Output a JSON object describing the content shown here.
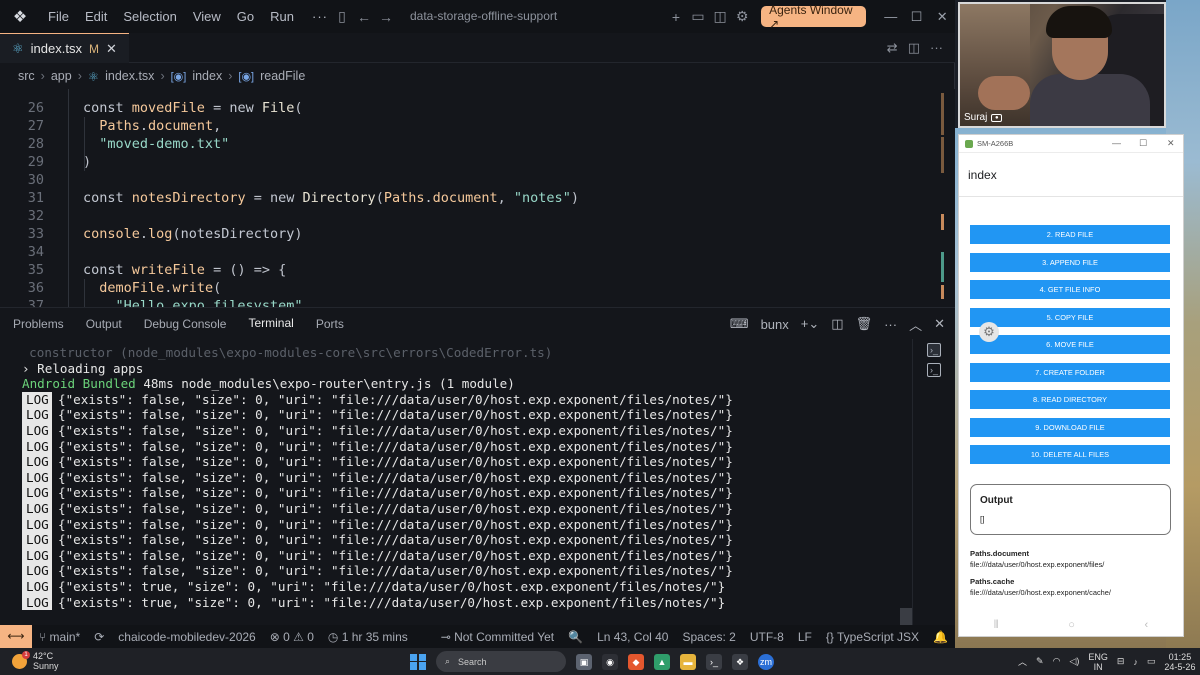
{
  "titlebar": {
    "menus": [
      "File",
      "Edit",
      "Selection",
      "View",
      "Go",
      "Run"
    ],
    "more": "···",
    "search_title": "data-storage-offline-support",
    "agents_button": "Agents Window ↗"
  },
  "tab": {
    "filename": "index.tsx",
    "modified": "M",
    "close": "✕"
  },
  "breadcrumb": [
    "src",
    "app",
    "index.tsx",
    "index",
    "readFile"
  ],
  "code_lines": [
    {
      "n": "26",
      "html": "<span class='kw'>const</span> <span class='var'>movedFile</span> <span class='pun'>=</span> <span class='kw'>new</span> <span class='cls'>File</span><span class='pun'>(</span>"
    },
    {
      "n": "27",
      "html": "  <span class='ob'>Paths</span><span class='pun'>.</span><span class='var'>document</span><span class='pun'>,</span>"
    },
    {
      "n": "28",
      "html": "  <span class='str'>\"moved-demo.txt\"</span>"
    },
    {
      "n": "29",
      "html": "<span class='pun'>)</span>"
    },
    {
      "n": "30",
      "html": ""
    },
    {
      "n": "31",
      "html": "<span class='kw'>const</span> <span class='var'>notesDirectory</span> <span class='pun'>=</span> <span class='kw'>new</span> <span class='cls'>Directory</span><span class='pun'>(</span><span class='ob'>Paths</span><span class='pun'>.</span><span class='var'>document</span><span class='pun'>,</span> <span class='str'>\"notes\"</span><span class='pun'>)</span>"
    },
    {
      "n": "32",
      "html": ""
    },
    {
      "n": "33",
      "html": "<span class='ob'>console</span><span class='pun'>.</span><span class='var'>log</span><span class='pun'>(</span><span class='kw'>notesDirectory</span><span class='pun'>)</span>"
    },
    {
      "n": "34",
      "html": ""
    },
    {
      "n": "35",
      "html": "<span class='kw'>const</span> <span class='var'>writeFile</span> <span class='pun'>= () =&gt; {</span>"
    },
    {
      "n": "36",
      "html": "  <span class='ob'>demoFile</span><span class='pun'>.</span><span class='var'>write</span><span class='pun'>(</span>"
    },
    {
      "n": "37",
      "html": "    <span class='str'>\"Hello expo filesystem\"</span>"
    }
  ],
  "panel": {
    "tabs": [
      "Problems",
      "Output",
      "Debug Console",
      "Terminal",
      "Ports"
    ],
    "active_tab": "Terminal",
    "shell": "bunx"
  },
  "terminal": {
    "faded_line": "  constructor (node_modules\\expo-modules-core\\src\\errors\\CodedError.ts)",
    "reload_line": "› Reloading apps",
    "bundled_prefix": "Android Bundled",
    "bundled_rest": " 48ms node_modules\\expo-router\\entry.js (1 module)",
    "log_badge": "LOG",
    "logs": [
      "{\"exists\": false, \"size\": 0, \"uri\": \"file:///data/user/0/host.exp.exponent/files/notes/\"}",
      "{\"exists\": false, \"size\": 0, \"uri\": \"file:///data/user/0/host.exp.exponent/files/notes/\"}",
      "{\"exists\": false, \"size\": 0, \"uri\": \"file:///data/user/0/host.exp.exponent/files/notes/\"}",
      "{\"exists\": false, \"size\": 0, \"uri\": \"file:///data/user/0/host.exp.exponent/files/notes/\"}",
      "{\"exists\": false, \"size\": 0, \"uri\": \"file:///data/user/0/host.exp.exponent/files/notes/\"}",
      "{\"exists\": false, \"size\": 0, \"uri\": \"file:///data/user/0/host.exp.exponent/files/notes/\"}",
      "{\"exists\": false, \"size\": 0, \"uri\": \"file:///data/user/0/host.exp.exponent/files/notes/\"}",
      "{\"exists\": false, \"size\": 0, \"uri\": \"file:///data/user/0/host.exp.exponent/files/notes/\"}",
      "{\"exists\": false, \"size\": 0, \"uri\": \"file:///data/user/0/host.exp.exponent/files/notes/\"}",
      "{\"exists\": false, \"size\": 0, \"uri\": \"file:///data/user/0/host.exp.exponent/files/notes/\"}",
      "{\"exists\": false, \"size\": 0, \"uri\": \"file:///data/user/0/host.exp.exponent/files/notes/\"}",
      "{\"exists\": false, \"size\": 0, \"uri\": \"file:///data/user/0/host.exp.exponent/files/notes/\"}",
      "{\"exists\": true, \"size\": 0, \"uri\": \"file:///data/user/0/host.exp.exponent/files/notes/\"}",
      "{\"exists\": true, \"size\": 0, \"uri\": \"file:///data/user/0/host.exp.exponent/files/notes/\"}"
    ]
  },
  "statusbar": {
    "branch": "main*",
    "project": "chaicode-mobiledev-2026",
    "errors": "0",
    "warnings": "0",
    "time": "1 hr 35 mins",
    "git": "Not Committed Yet",
    "position": "Ln 43, Col 40",
    "spaces": "Spaces: 2",
    "encoding": "UTF-8",
    "eol": "LF",
    "language": "TypeScript JSX"
  },
  "webcam": {
    "name": "Suraj"
  },
  "emulator": {
    "device": "SM-A266B",
    "screen_title": "index",
    "buttons": [
      "2. Read file",
      "3. Append file",
      "4. Get file info",
      "5. Copy file",
      "6. Move file",
      "7. Create folder",
      "8. Read directory",
      "9. Download file",
      "10. Delete all files"
    ],
    "output_title": "Output",
    "output_value": "[]",
    "paths": [
      {
        "label": "Paths.document",
        "value": "file:///data/user/0/host.exp.exponent/files/"
      },
      {
        "label": "Paths.cache",
        "value": "file:///data/user/0/host.exp.exponent/cache/"
      }
    ]
  },
  "taskbar": {
    "temp": "42°C",
    "weather": "Sunny",
    "weather_badge": "1",
    "search": "Search",
    "lang_line1": "ENG",
    "lang_line2": "IN",
    "time": "01:25",
    "date": "24-5-26"
  }
}
